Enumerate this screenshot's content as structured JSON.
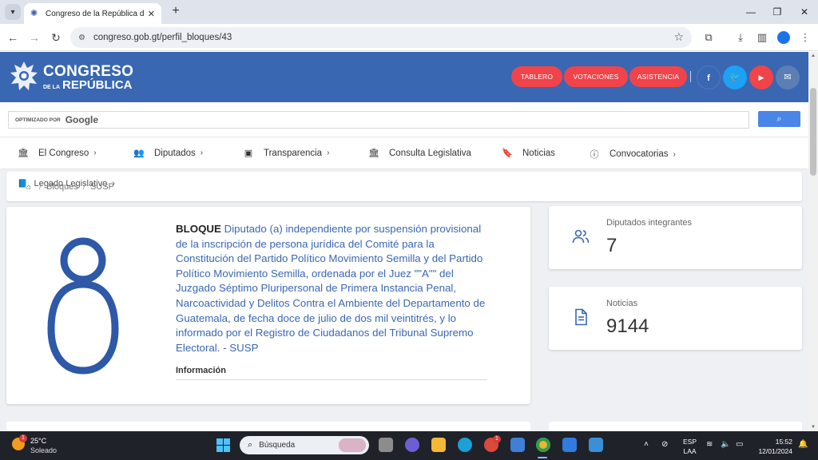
{
  "browser": {
    "tab_title": "Congreso de la República de Gu",
    "url": "congreso.gob.gt/perfil_bloques/43"
  },
  "header": {
    "logo_line1": "CONGRESO",
    "logo_line2_small": "DE LA",
    "logo_line2": "REPÚBLICA",
    "buttons": [
      "TABLERO",
      "VOTACIONES",
      "ASISTENCIA"
    ],
    "social": [
      {
        "name": "facebook-icon",
        "glyph": "f",
        "color": "#3967b2"
      },
      {
        "name": "twitter-icon",
        "glyph": "t",
        "color": "#1da1f2"
      },
      {
        "name": "youtube-icon",
        "glyph": "▶",
        "color": "#f0444a"
      },
      {
        "name": "mail-icon",
        "glyph": "✉",
        "color": "#5b7fb5"
      }
    ]
  },
  "search": {
    "optimized_by": "OPTIMIZADO POR",
    "provider": "Google"
  },
  "nav": {
    "items": [
      {
        "label": "El Congreso",
        "icon": "building-icon",
        "has_chevron": true
      },
      {
        "label": "Diputados",
        "icon": "users-icon",
        "has_chevron": true
      },
      {
        "label": "Transparencia",
        "icon": "archive-icon",
        "has_chevron": true
      },
      {
        "label": "Consulta Legislativa",
        "icon": "building-icon",
        "has_chevron": false
      },
      {
        "label": "Noticias",
        "icon": "bookmark-icon",
        "has_chevron": false
      },
      {
        "label": "Convocatorias",
        "icon": "info-icon",
        "has_chevron": true
      }
    ],
    "legado": "Legado Legislativo"
  },
  "breadcrumb": {
    "items": [
      "Bloques",
      "SUSP"
    ]
  },
  "bloque": {
    "label": "BLOQUE",
    "name": "Diputado (a) independiente por suspensión provisional de la inscripción de persona jurídica del Comité para la Constitución del Partido Político Movimiento Semilla y del Partido Político Movimiento Semilla, ordenada por el Juez \"\"A\"\" del Juzgado Séptimo Pluripersonal de Primera Instancia Penal, Narcoactividad y Delitos Contra el Ambiente del Departamento de Guatemala, de fecha doce de julio de dos mil veintitrés, y lo informado por el Registro de Ciudadanos del Tribunal Supremo Electoral. - SUSP",
    "info_label": "Información"
  },
  "stats": [
    {
      "label": "Diputados integrantes",
      "value": "7",
      "icon": "users-outline-icon"
    },
    {
      "label": "Noticias",
      "value": "9144",
      "icon": "document-icon"
    }
  ],
  "taskbar": {
    "temperature": "25°C",
    "condition": "Soleado",
    "weather_badge": "1",
    "search_placeholder": "Búsqueda",
    "app_badge": "1",
    "lang_line1": "ESP",
    "lang_line2": "LAA",
    "time": "15:52",
    "date": "12/01/2024"
  },
  "colors": {
    "brand_blue": "#3967b2",
    "accent_red": "#f0444a",
    "text_blue": "#3a67b1"
  }
}
